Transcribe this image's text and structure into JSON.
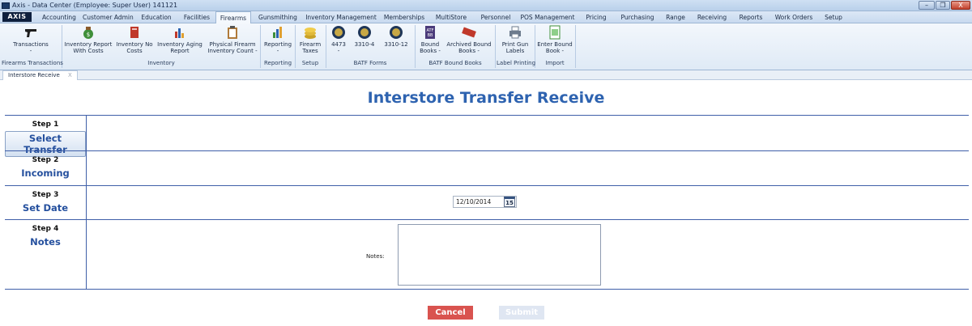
{
  "window": {
    "title": "Axis - Data Center  (Employee: Super User) 141121",
    "minimize_label": "–",
    "restore_label": "❐",
    "close_label": "X"
  },
  "menu": {
    "logo": "AXIS",
    "tabs": [
      "Accounting",
      "Customer Admin",
      "Education",
      "Facilities",
      "Firearms",
      "Gunsmithing",
      "Inventory Management",
      "Memberships",
      "MultiStore",
      "Personnel",
      "POS Management",
      "Pricing",
      "Purchasing",
      "Range",
      "Receiving",
      "Reports",
      "Work Orders",
      "Setup"
    ],
    "active_tab": "Firearms"
  },
  "ribbon": {
    "buttons": [
      {
        "label": "Transactions\n-",
        "icon": "pistol-icon"
      },
      {
        "label": "Inventory Report\nWith Costs",
        "icon": "money-bag-icon"
      },
      {
        "label": "Inventory No\nCosts",
        "icon": "book-icon"
      },
      {
        "label": "Inventory Aging\nReport",
        "icon": "bar-chart-icon"
      },
      {
        "label": "Physical Firearm\nInventory Count -",
        "icon": "clipboard-icon"
      },
      {
        "label": "Reporting\n-",
        "icon": "report-chart-icon"
      },
      {
        "label": "Firearm\nTaxes",
        "icon": "coins-icon"
      },
      {
        "label": "4473\n-",
        "icon": "seal-icon"
      },
      {
        "label": "3310-4",
        "icon": "seal-icon"
      },
      {
        "label": "3310-12",
        "icon": "seal-icon"
      },
      {
        "label": "Bound\nBooks -",
        "icon": "bound-book-icon"
      },
      {
        "label": "Archived Bound\nBooks -",
        "icon": "archived-stamp-icon"
      },
      {
        "label": "Print Gun\nLabels",
        "icon": "printer-icon"
      },
      {
        "label": "Enter Bound\nBook -",
        "icon": "spreadsheet-icon"
      }
    ],
    "groups": [
      "Firearms Transactions",
      "Inventory",
      "Reporting",
      "Setup",
      "BATF Forms",
      "BATF Bound Books",
      "Label Printing",
      "Import"
    ],
    "stamp_text": "ARCHIVED",
    "book_text": "ATF\nBB"
  },
  "doc_tab": {
    "label": "Interstore Receive",
    "close": "X"
  },
  "page": {
    "title": "Interstore Transfer Receive",
    "steps": [
      {
        "number": "Step 1",
        "name": "Select Transfer"
      },
      {
        "number": "Step 2",
        "name": "Incoming"
      },
      {
        "number": "Step 3",
        "name": "Set Date"
      },
      {
        "number": "Step 4",
        "name": "Notes"
      }
    ],
    "date_value": "12/10/2014",
    "calendar_label": "15",
    "notes_label": "Notes:",
    "notes_value": "",
    "cancel_label": "Cancel",
    "submit_label": "Submit"
  },
  "colors": {
    "accent": "#2e63b0",
    "step_border": "#3f5fa8",
    "cancel": "#d9534f",
    "submit_disabled": "#dfe6f2"
  }
}
